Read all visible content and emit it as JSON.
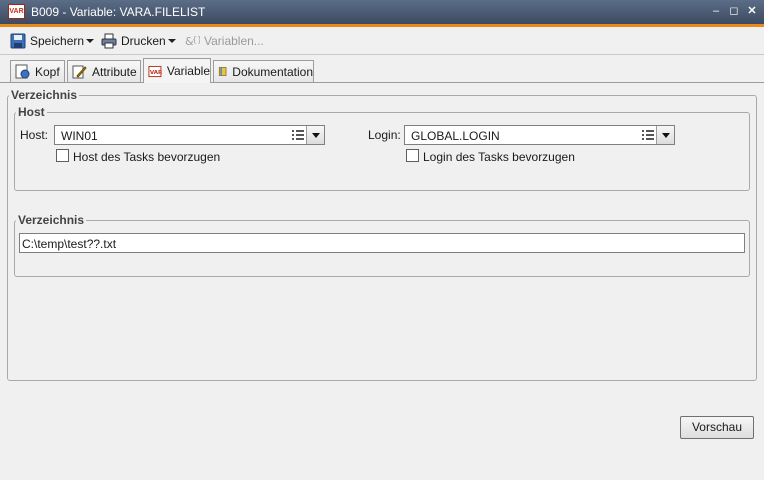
{
  "window": {
    "title": "B009 - Variable: VARA.FILELIST",
    "app_icon_text": "VAR"
  },
  "toolbar": {
    "save_label": "Speichern",
    "print_label": "Drucken",
    "variables_label": "Variablen..."
  },
  "tabs": [
    {
      "label": "Kopf"
    },
    {
      "label": "Attribute"
    },
    {
      "label": "Variable",
      "active": true
    },
    {
      "label": "Dokumentation"
    }
  ],
  "verzeichnis_group": {
    "legend": "Verzeichnis",
    "host_group": {
      "legend": "Host",
      "host_label": "Host:",
      "host_value": "WIN01",
      "host_checkbox_label": "Host des Tasks bevorzugen",
      "login_label": "Login:",
      "login_value": "GLOBAL.LOGIN",
      "login_checkbox_label": "Login des Tasks bevorzugen"
    },
    "path_group": {
      "legend": "Verzeichnis",
      "path_value": "C:\\temp\\test??.txt"
    }
  },
  "preview_button": "Vorschau",
  "colors": {
    "titlebar": "#4a5a74",
    "accent": "#e98a1c"
  }
}
